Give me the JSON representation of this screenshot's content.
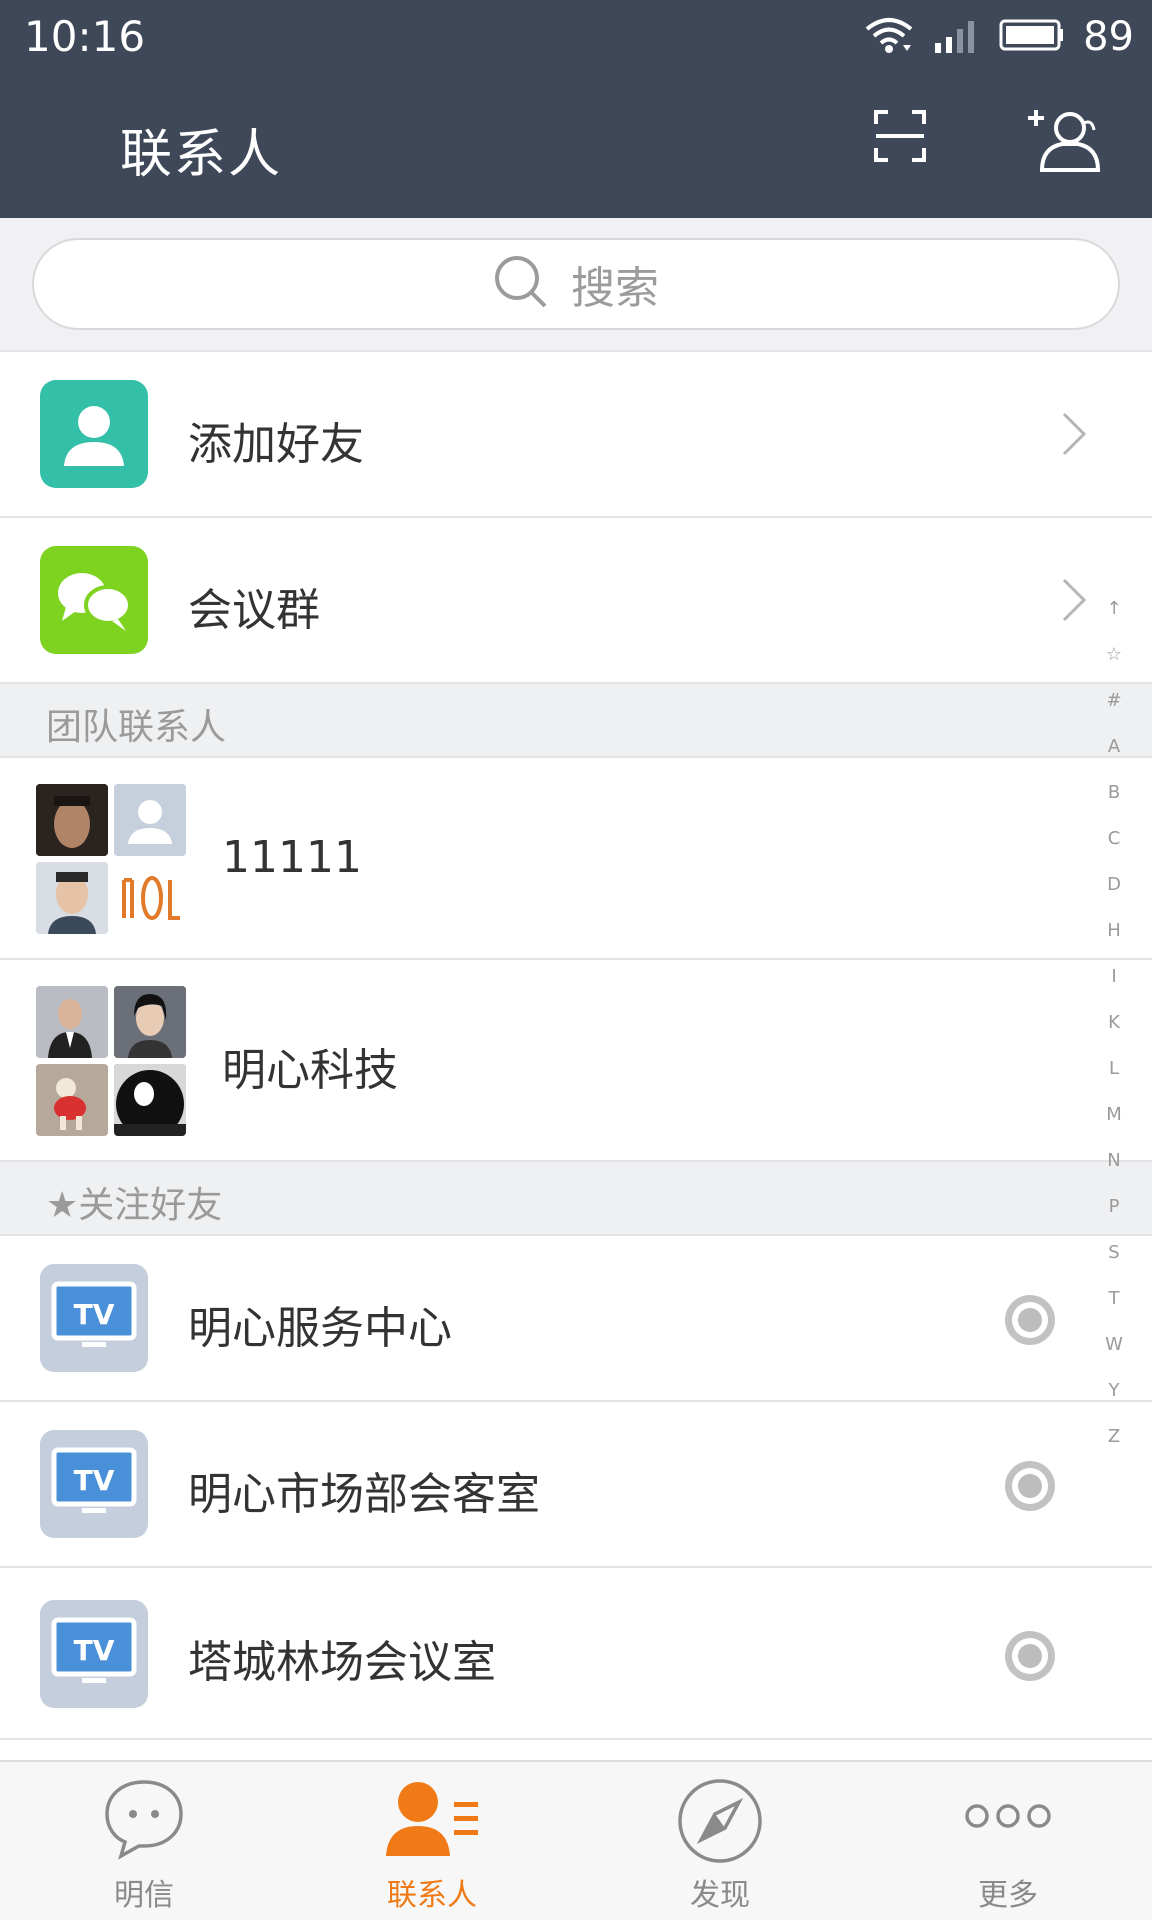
{
  "status_bar": {
    "time": "10:16",
    "battery_percent": "89"
  },
  "header": {
    "title": "联系人"
  },
  "search": {
    "placeholder": "搜索"
  },
  "entries": [
    {
      "label": "添加好友",
      "icon": "add-contact-icon",
      "color": "#33bfa8"
    },
    {
      "label": "会议群",
      "icon": "chat-bubbles-icon",
      "color": "#7ed321"
    }
  ],
  "team_section": {
    "title": "团队联系人",
    "groups": [
      {
        "name": "11111"
      },
      {
        "name": "明心科技"
      }
    ]
  },
  "follow_section": {
    "title": "★关注好友",
    "items": [
      {
        "name": "明心服务中心",
        "icon_text": "TV"
      },
      {
        "name": "明心市场部会客室",
        "icon_text": "TV"
      },
      {
        "name": "塔城林场会议室",
        "icon_text": "TV"
      }
    ]
  },
  "index_bar": [
    "↑",
    "☆",
    "#",
    "A",
    "B",
    "C",
    "D",
    "H",
    "I",
    "K",
    "L",
    "M",
    "N",
    "P",
    "S",
    "T",
    "W",
    "Y",
    "Z"
  ],
  "tabs": [
    {
      "label": "明信",
      "icon": "chat-icon",
      "active": false
    },
    {
      "label": "联系人",
      "icon": "contacts-icon",
      "active": true
    },
    {
      "label": "发现",
      "icon": "compass-icon",
      "active": false
    },
    {
      "label": "更多",
      "icon": "more-icon",
      "active": false
    }
  ],
  "colors": {
    "header_bg": "#3e4858",
    "accent": "#f07a16",
    "tv_icon_bg": "#c5cedc"
  }
}
